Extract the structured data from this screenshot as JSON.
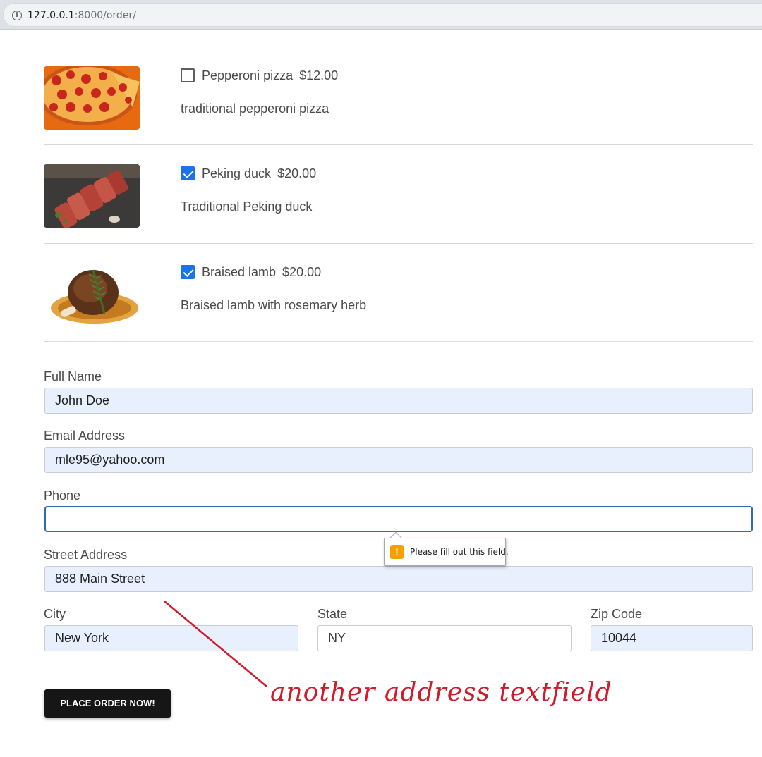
{
  "browser": {
    "url_host": "127.0.0.1",
    "url_rest": ":8000/order/",
    "info_icon": "i"
  },
  "menu": {
    "items": [
      {
        "name": "Pepperoni pizza",
        "price": "$12.00",
        "description": "traditional pepperoni pizza",
        "checked": false,
        "image": "pepperoni-pizza-photo"
      },
      {
        "name": "Peking duck",
        "price": "$20.00",
        "description": "Traditional Peking duck",
        "checked": true,
        "image": "peking-duck-photo"
      },
      {
        "name": "Braised lamb",
        "price": "$20.00",
        "description": "Braised lamb with rosemary herb",
        "checked": true,
        "image": "braised-lamb-photo"
      }
    ]
  },
  "form": {
    "full_name": {
      "label": "Full Name",
      "value": "John Doe"
    },
    "email": {
      "label": "Email Address",
      "value": "mle95@yahoo.com"
    },
    "phone": {
      "label": "Phone",
      "value": ""
    },
    "street": {
      "label": "Street Address",
      "value": "888 Main Street"
    },
    "city": {
      "label": "City",
      "value": "New York"
    },
    "state": {
      "label": "State",
      "value": "NY"
    },
    "zip": {
      "label": "Zip Code",
      "value": "10044"
    },
    "validation_message": "Please fill out this field.",
    "warning_icon": "!",
    "submit_label": "PLACE ORDER NOW!"
  },
  "annotation": {
    "text": "another address textfield",
    "color": "#d11a2a"
  },
  "colors": {
    "autofill_bg": "#e8f0fe",
    "checkbox_blue": "#1a73e8",
    "focus_border": "#3569b0",
    "button_bg": "#161616",
    "warning": "#f5a000"
  }
}
